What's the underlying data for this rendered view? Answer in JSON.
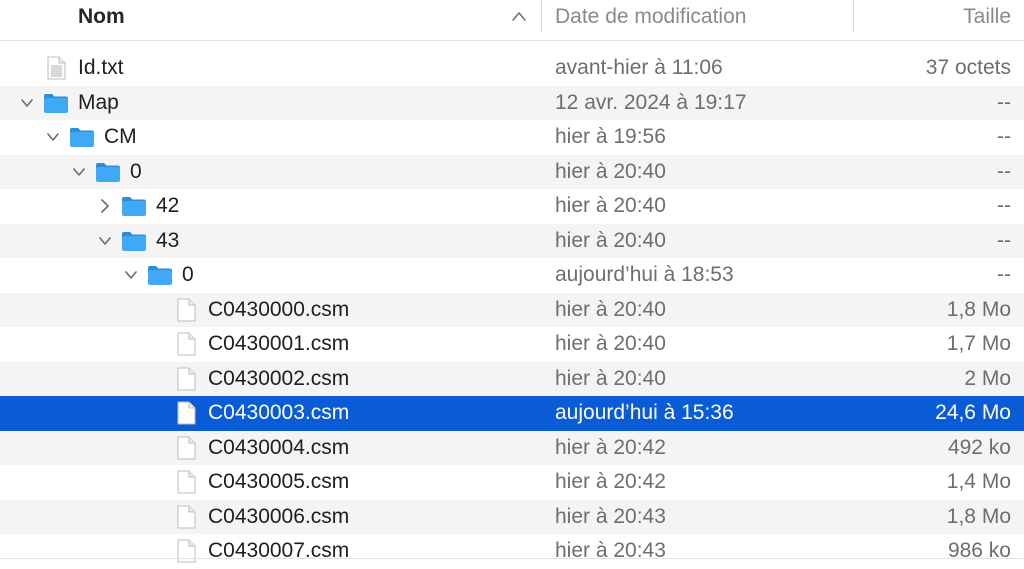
{
  "header": {
    "name_label": "Nom",
    "date_label": "Date de modification",
    "size_label": "Taille",
    "sort_icon": "chevron-up-icon"
  },
  "colors": {
    "selection": "#0a5cd6",
    "folder": "#3fa9f5",
    "alternate_row": "#f4f4f5"
  },
  "rows": [
    {
      "name": "Id.txt",
      "date": "avant-hier à 11:06",
      "size": "37 octets",
      "type": "text-file",
      "depth": 0,
      "disclosure": "none",
      "selected": false
    },
    {
      "name": "Map",
      "date": "12 avr. 2024 à 19:17",
      "size": "--",
      "type": "folder",
      "depth": 0,
      "disclosure": "expanded",
      "selected": false
    },
    {
      "name": "CM",
      "date": "hier à 19:56",
      "size": "--",
      "type": "folder",
      "depth": 1,
      "disclosure": "expanded",
      "selected": false
    },
    {
      "name": "0",
      "date": "hier à 20:40",
      "size": "--",
      "type": "folder",
      "depth": 2,
      "disclosure": "expanded",
      "selected": false
    },
    {
      "name": "42",
      "date": "hier à 20:40",
      "size": "--",
      "type": "folder",
      "depth": 3,
      "disclosure": "collapsed",
      "selected": false
    },
    {
      "name": "43",
      "date": "hier à 20:40",
      "size": "--",
      "type": "folder",
      "depth": 3,
      "disclosure": "expanded",
      "selected": false
    },
    {
      "name": "0",
      "date": "aujourd’hui à 18:53",
      "size": "--",
      "type": "folder",
      "depth": 4,
      "disclosure": "expanded",
      "selected": false
    },
    {
      "name": "C0430000.csm",
      "date": "hier à 20:40",
      "size": "1,8 Mo",
      "type": "file",
      "depth": 5,
      "disclosure": "none",
      "selected": false
    },
    {
      "name": "C0430001.csm",
      "date": "hier à 20:40",
      "size": "1,7 Mo",
      "type": "file",
      "depth": 5,
      "disclosure": "none",
      "selected": false
    },
    {
      "name": "C0430002.csm",
      "date": "hier à 20:40",
      "size": "2 Mo",
      "type": "file",
      "depth": 5,
      "disclosure": "none",
      "selected": false
    },
    {
      "name": "C0430003.csm",
      "date": "aujourd’hui à 15:36",
      "size": "24,6 Mo",
      "type": "file",
      "depth": 5,
      "disclosure": "none",
      "selected": true
    },
    {
      "name": "C0430004.csm",
      "date": "hier à 20:42",
      "size": "492 ko",
      "type": "file",
      "depth": 5,
      "disclosure": "none",
      "selected": false
    },
    {
      "name": "C0430005.csm",
      "date": "hier à 20:42",
      "size": "1,4 Mo",
      "type": "file",
      "depth": 5,
      "disclosure": "none",
      "selected": false
    },
    {
      "name": "C0430006.csm",
      "date": "hier à 20:43",
      "size": "1,8 Mo",
      "type": "file",
      "depth": 5,
      "disclosure": "none",
      "selected": false
    },
    {
      "name": "C0430007.csm",
      "date": "hier à 20:43",
      "size": "986 ko",
      "type": "file",
      "depth": 5,
      "disclosure": "none",
      "selected": false
    }
  ]
}
